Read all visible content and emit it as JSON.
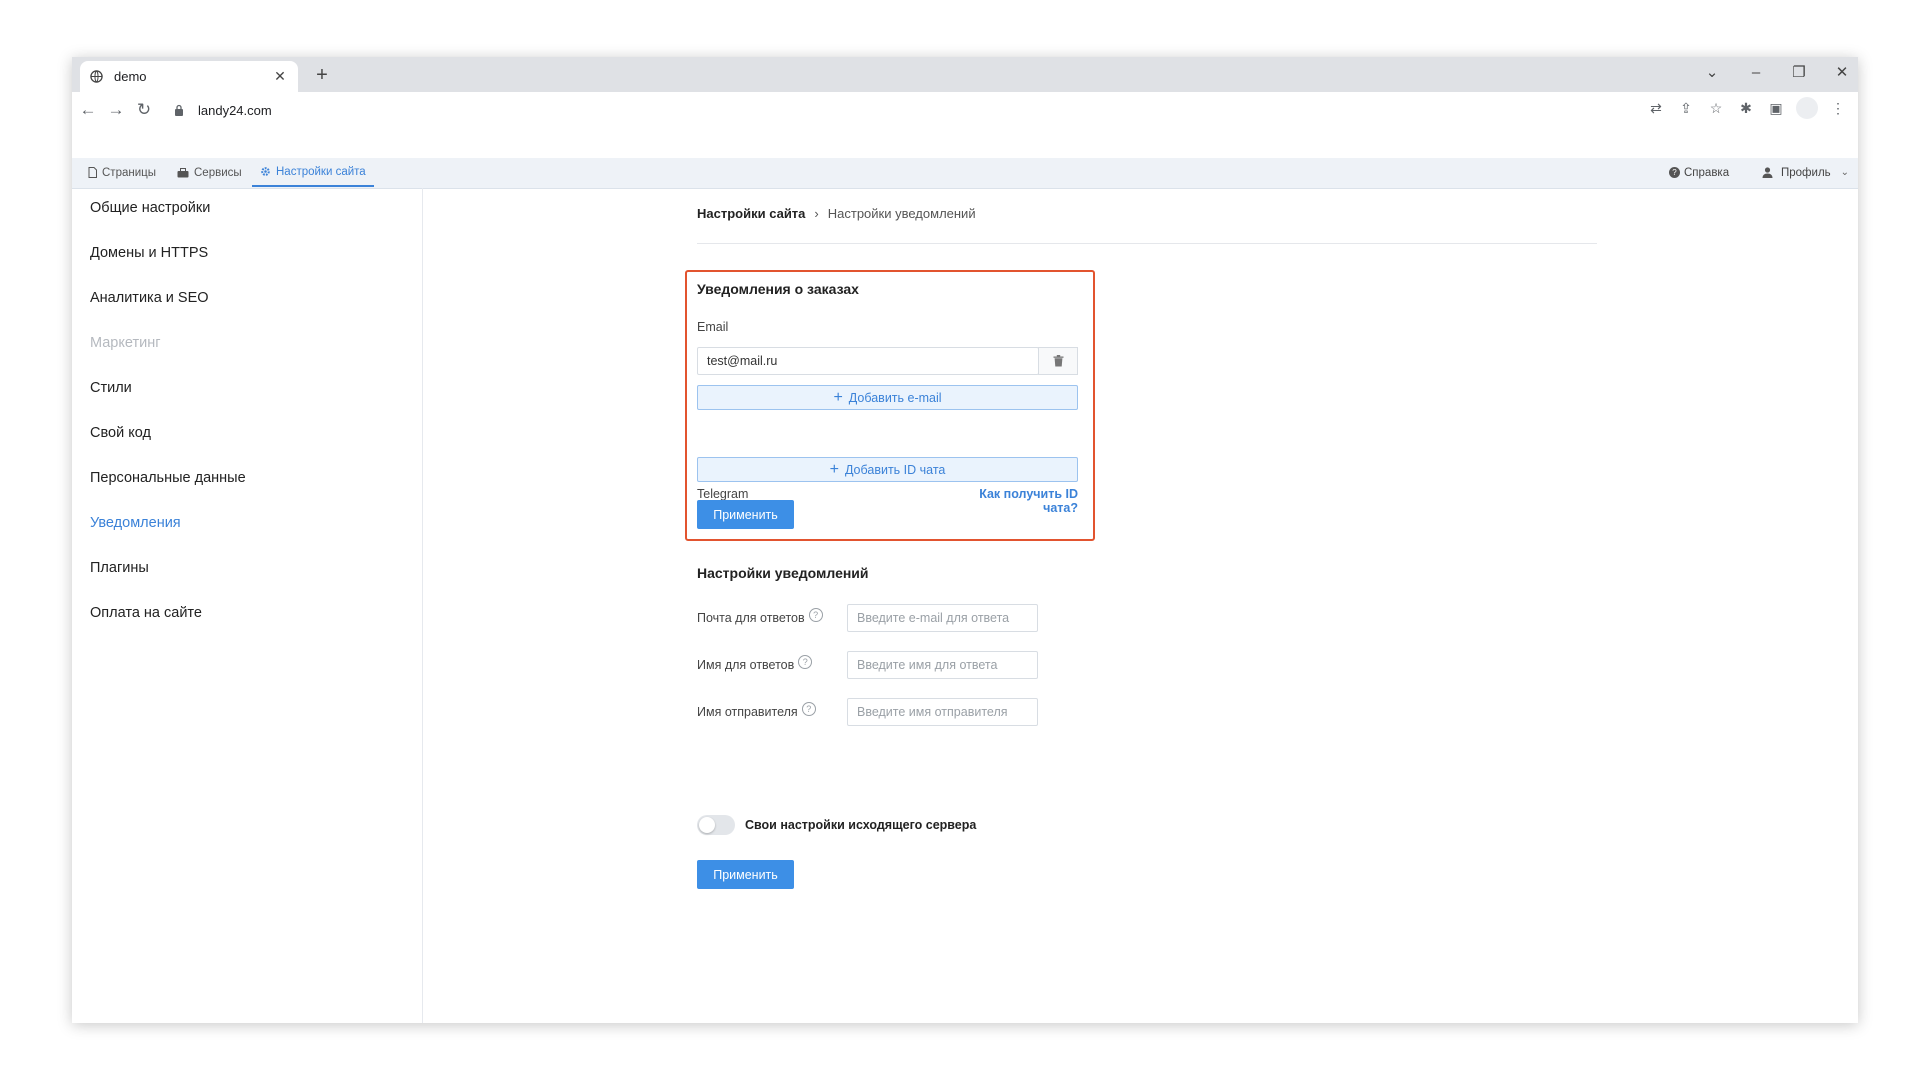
{
  "browser": {
    "tab_title": "demo",
    "url": "landy24.com"
  },
  "app": {
    "tabs": [
      {
        "label": "Страницы",
        "icon": "page-icon"
      },
      {
        "label": "Сервисы",
        "icon": "services-icon"
      },
      {
        "label": "Настройки сайта",
        "icon": "gear-icon"
      }
    ],
    "active_tab": "Настройки сайта",
    "help_label": "Справка",
    "profile_label": "Профиль",
    "accent_color": "#3b82d8"
  },
  "sidebar": {
    "items": [
      {
        "label": "Общие настройки",
        "state": "normal"
      },
      {
        "label": "Домены и HTTPS",
        "state": "normal"
      },
      {
        "label": "Аналитика и SEO",
        "state": "normal"
      },
      {
        "label": "Маркетинг",
        "state": "disabled"
      },
      {
        "label": "Стили",
        "state": "normal"
      },
      {
        "label": "Свой код",
        "state": "normal"
      },
      {
        "label": "Персональные данные",
        "state": "normal"
      },
      {
        "label": "Уведомления",
        "state": "active"
      },
      {
        "label": "Плагины",
        "state": "normal"
      },
      {
        "label": "Оплата на сайте",
        "state": "normal"
      }
    ]
  },
  "breadcrumb": {
    "parent": "Настройки сайта",
    "separator": "›",
    "current": "Настройки уведомлений"
  },
  "orders": {
    "title": "Уведомления о заказах",
    "email_label": "Email",
    "email_value": "test@mail.ru",
    "add_email_label": "Добавить e-mail",
    "telegram_label": "Telegram",
    "chat_id_link": "Как получить ID чата?",
    "add_chat_label": "Добавить ID чата",
    "apply_label": "Применить"
  },
  "notify_settings": {
    "title": "Настройки уведомлений",
    "reply_email_label": "Почта для ответов",
    "reply_email_placeholder": "Введите e-mail для ответа",
    "reply_name_label": "Имя для ответов",
    "reply_name_placeholder": "Введите имя для ответа",
    "sender_name_label": "Имя отправителя",
    "sender_name_placeholder": "Введите имя отправителя",
    "smtp_toggle_label": "Свои настройки исходящего сервера",
    "smtp_toggle_on": false,
    "apply_label": "Применить"
  }
}
